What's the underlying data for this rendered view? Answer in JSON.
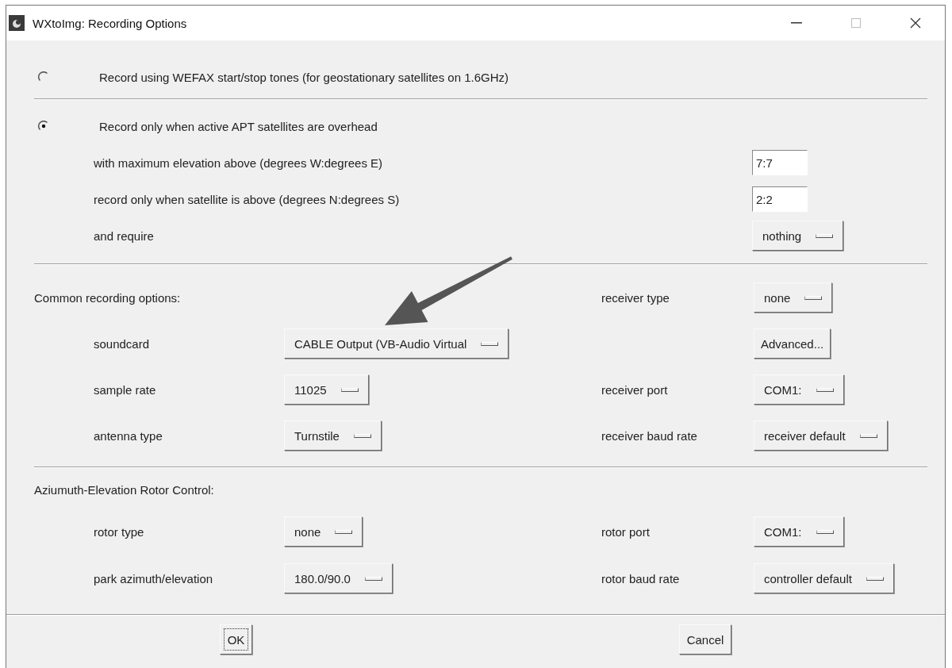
{
  "window": {
    "title": "WXtoImg: Recording Options"
  },
  "mode_options": [
    {
      "label": "Record using WEFAX start/stop tones (for geostationary satellites on 1.6GHz)",
      "selected": false
    },
    {
      "label": "Record only when active APT satellites are overhead",
      "selected": true
    }
  ],
  "apt_settings": [
    {
      "kind": "field",
      "label": "with maximum elevation above (degrees W:degrees E)",
      "value": "7:7"
    },
    {
      "kind": "field",
      "label": "record only when satellite is above (degrees N:degrees S)",
      "value": "2:2"
    },
    {
      "kind": "dropdown",
      "label": "and require",
      "value": "nothing"
    }
  ],
  "common": {
    "heading": "Common recording options:",
    "heading_side": {
      "kind": "dropdown",
      "label": "receiver type",
      "value": "none"
    },
    "rows": [
      {
        "left": {
          "kind": "dropdown",
          "label": "soundcard",
          "value": "CABLE Output (VB-Audio Virtual"
        },
        "right": {
          "kind": "button",
          "value": "Advanced..."
        }
      },
      {
        "left": {
          "kind": "dropdown",
          "label": "sample rate",
          "value": "11025"
        },
        "right": {
          "kind": "dropdown",
          "label": "receiver port",
          "value": "COM1:"
        }
      },
      {
        "left": {
          "kind": "dropdown",
          "label": "antenna type",
          "value": "Turnstile"
        },
        "right": {
          "kind": "dropdown",
          "label": "receiver baud rate",
          "value": "receiver default"
        }
      }
    ]
  },
  "rotor": {
    "heading": "Aziumuth-Elevation Rotor Control:",
    "rows": [
      {
        "left": {
          "kind": "dropdown",
          "label": "rotor type",
          "value": "none"
        },
        "right": {
          "kind": "dropdown",
          "label": "rotor port",
          "value": "COM1:"
        }
      },
      {
        "left": {
          "kind": "dropdown",
          "label": "park azimuth/elevation",
          "value": "180.0/90.0"
        },
        "right": {
          "kind": "dropdown",
          "label": "rotor baud rate",
          "value": "controller default"
        }
      }
    ]
  },
  "buttons": [
    {
      "label": "OK",
      "focused": true
    },
    {
      "label": "Cancel",
      "focused": false
    }
  ]
}
